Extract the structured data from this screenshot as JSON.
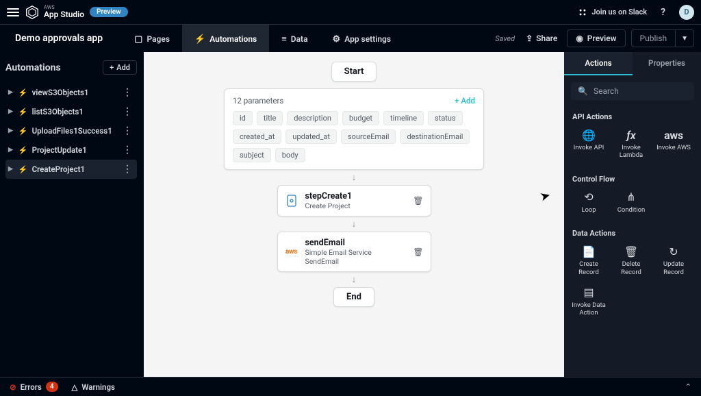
{
  "header": {
    "product_line1": "AWS",
    "product_line2": "App Studio",
    "preview_badge": "Preview",
    "slack": "Join us on Slack",
    "help": "?",
    "avatar_initial": "D"
  },
  "subheader": {
    "app_title": "Demo approvals app",
    "tabs": {
      "pages": "Pages",
      "automations": "Automations",
      "data": "Data",
      "app_settings": "App settings"
    },
    "saved": "Saved",
    "share": "Share",
    "preview": "Preview",
    "publish": "Publish"
  },
  "sidebar": {
    "title": "Automations",
    "add": "Add",
    "items": [
      {
        "name": "viewS3Objects1"
      },
      {
        "name": "listS3Objects1"
      },
      {
        "name": "UploadFiles1Success1"
      },
      {
        "name": "ProjectUpdate1"
      },
      {
        "name": "CreateProject1"
      }
    ]
  },
  "canvas": {
    "start": "Start",
    "end": "End",
    "params": {
      "count_label": "12 parameters",
      "add": "+  Add",
      "chips": [
        "id",
        "title",
        "description",
        "budget",
        "timeline",
        "status",
        "created_at",
        "updated_at",
        "sourceEmail",
        "destinationEmail",
        "subject",
        "body"
      ]
    },
    "step1": {
      "title": "stepCreate1",
      "sub": "Create Project"
    },
    "step2": {
      "title": "sendEmail",
      "sub": "Simple Email Service SendEmail",
      "aws": "aws"
    }
  },
  "right": {
    "tabs": {
      "actions": "Actions",
      "properties": "Properties"
    },
    "search_placeholder": "Search",
    "sections": {
      "api": "API Actions",
      "control": "Control Flow",
      "data": "Data Actions"
    },
    "actions": {
      "invoke_api": "Invoke API",
      "invoke_lambda": "Invoke Lambda",
      "invoke_aws": "Invoke AWS",
      "aws": "aws",
      "loop": "Loop",
      "condition": "Condition",
      "create_record": "Create Record",
      "delete_record": "Delete Record",
      "update_record": "Update Record",
      "invoke_data": "Invoke Data Action"
    }
  },
  "footer": {
    "errors": "Errors",
    "error_count": "4",
    "warnings": "Warnings"
  }
}
